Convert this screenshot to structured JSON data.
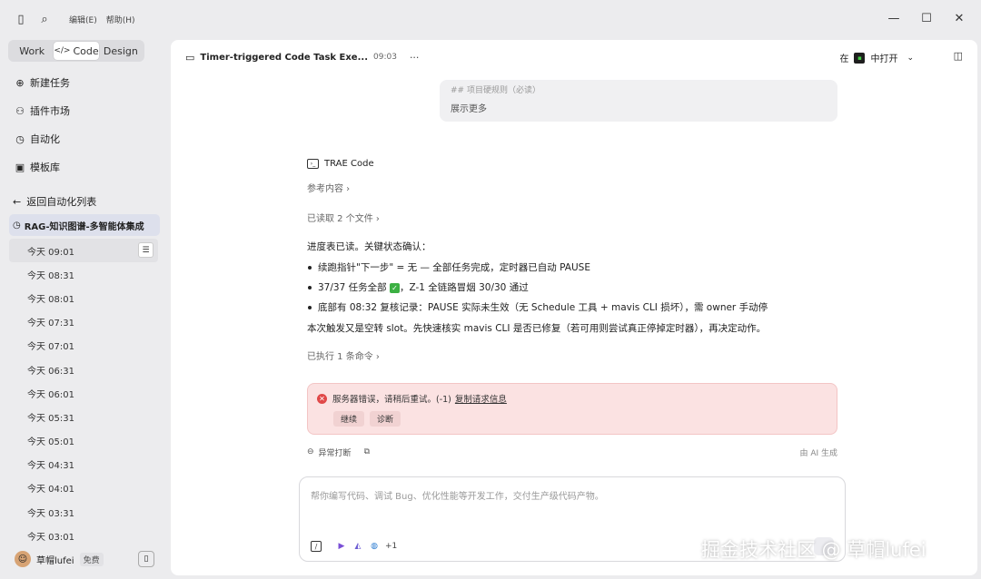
{
  "titlebar": {
    "menu": [
      "编辑(E)",
      "帮助(H)"
    ]
  },
  "sidebar": {
    "mode_tabs": [
      "Work",
      "Code",
      "Design"
    ],
    "active_tab": "Code",
    "nav": [
      {
        "label": "新建任务",
        "icon": "plus-circle-icon"
      },
      {
        "label": "插件市场",
        "icon": "plugin-icon"
      },
      {
        "label": "自动化",
        "icon": "alarm-clock-icon"
      },
      {
        "label": "模板库",
        "icon": "template-icon"
      }
    ],
    "back_label": "返回自动化列表",
    "automation_name": "RAG-知识图谱-多智能体集成",
    "runs": [
      "今天 09:01",
      "今天 08:31",
      "今天 08:01",
      "今天 07:31",
      "今天 07:01",
      "今天 06:31",
      "今天 06:01",
      "今天 05:31",
      "今天 05:01",
      "今天 04:31",
      "今天 04:01",
      "今天 03:31",
      "今天 03:01"
    ],
    "user": {
      "name": "草帽lufei",
      "plan": "免费"
    }
  },
  "main": {
    "title": "Timer-triggered Code Task Exe...",
    "time": "09:03",
    "open_in_prefix": "在",
    "open_in_suffix": "中打开",
    "user_message": {
      "line1": "## 项目硬规则（必读）",
      "show_more": "展示更多"
    },
    "agent_name": "TRAE Code",
    "reference": "参考内容 ›",
    "files_read": "已读取 2 个文件 ›",
    "intro": "进度表已读。关键状态确认：",
    "bullets": [
      "续跑指针\"下一步\" = 无 — 全部任务完成，定时器已自动 PAUSE",
      "37/37 任务全部",
      "，Z-1 全链路冒烟 30/30 通过",
      "底部有 08:32 复核记录：PAUSE 实际未生效（无 Schedule 工具 + mavis CLI 损坏），需 owner 手动停"
    ],
    "summary": "本次触发又是空转 slot。先快速核实 mavis CLI 是否已修复（若可用则尝试真正停掉定时器），再决定动作。",
    "commands_run": "已执行 1 条命令 ›",
    "error": {
      "message": "服务器错误，请稍后重试。(-1)",
      "link": "复制请求信息",
      "buttons": [
        "继续",
        "诊断"
      ]
    },
    "abnormal_interrupt": "异常打断",
    "ai_generated": "由 AI 生成",
    "input_placeholder": "帮你编写代码、调试 Bug、优化性能等开发工作，交付生产级代码产物。",
    "more_tools": "+1"
  },
  "watermark": "掘金技术社区 @ 草帽lufei"
}
